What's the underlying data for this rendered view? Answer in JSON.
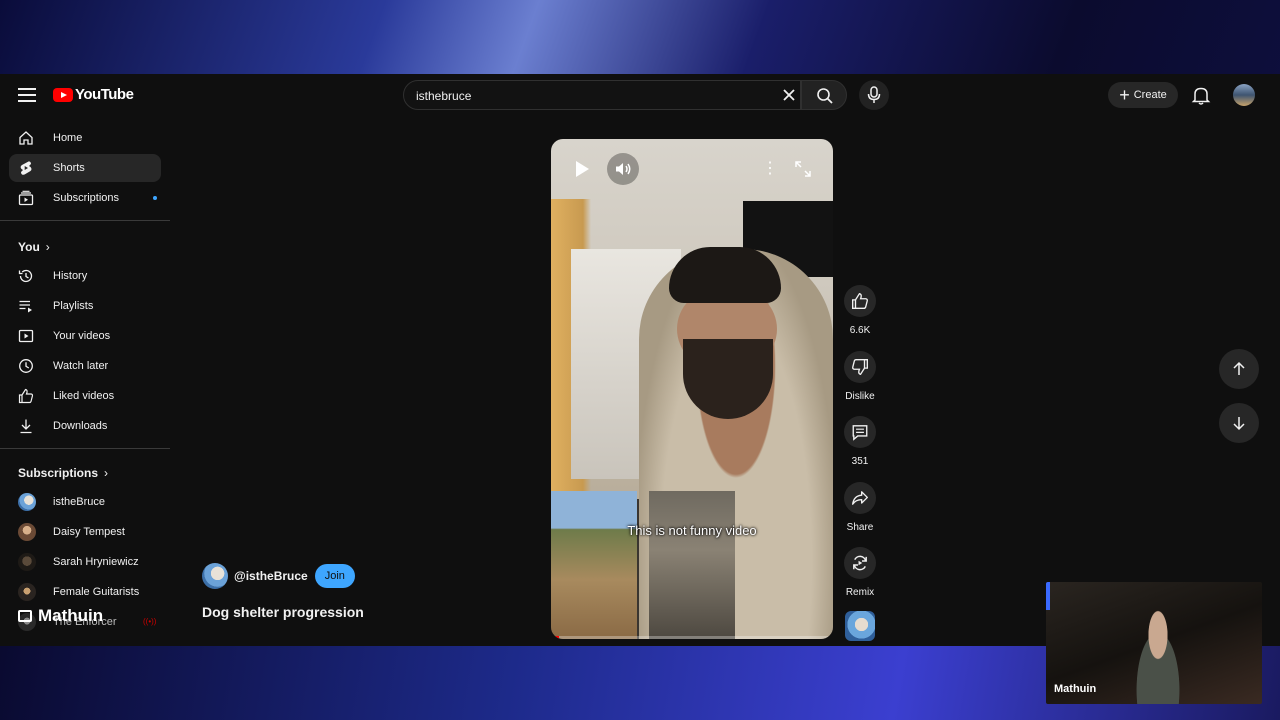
{
  "header": {
    "logo_text": "YouTube",
    "search_value": "isthebruce",
    "create_label": "Create"
  },
  "sidebar": {
    "main": [
      {
        "label": "Home",
        "icon": "home-icon"
      },
      {
        "label": "Shorts",
        "icon": "shorts-icon",
        "active": true
      },
      {
        "label": "Subscriptions",
        "icon": "subscriptions-icon"
      }
    ],
    "you_heading": "You",
    "you_items": [
      {
        "label": "History",
        "icon": "history-icon"
      },
      {
        "label": "Playlists",
        "icon": "playlists-icon"
      },
      {
        "label": "Your videos",
        "icon": "your-videos-icon"
      },
      {
        "label": "Watch later",
        "icon": "clock-icon"
      },
      {
        "label": "Liked videos",
        "icon": "thumbs-up-icon"
      },
      {
        "label": "Downloads",
        "icon": "download-icon"
      }
    ],
    "subscriptions_heading": "Subscriptions",
    "subscriptions": [
      {
        "label": "istheBruce"
      },
      {
        "label": "Daisy Tempest"
      },
      {
        "label": "Sarah Hryniewicz"
      },
      {
        "label": "Female Guitarists"
      },
      {
        "label": "The Enforcer"
      }
    ]
  },
  "short": {
    "channel_handle": "@istheBruce",
    "join_label": "Join",
    "title": "Dog shelter progression",
    "caption": "This is not funny video",
    "progress_fraction": 0.03
  },
  "actions": {
    "likes": "6.6K",
    "dislike_label": "Dislike",
    "comments": "351",
    "share_label": "Share",
    "remix_label": "Remix"
  },
  "overlay": {
    "stream_label": "Mathuin",
    "webcam_name": "Mathuin"
  },
  "colors": {
    "accent_blue": "#3ea6ff",
    "youtube_red": "#ff0000",
    "background": "#0f0f0f"
  }
}
